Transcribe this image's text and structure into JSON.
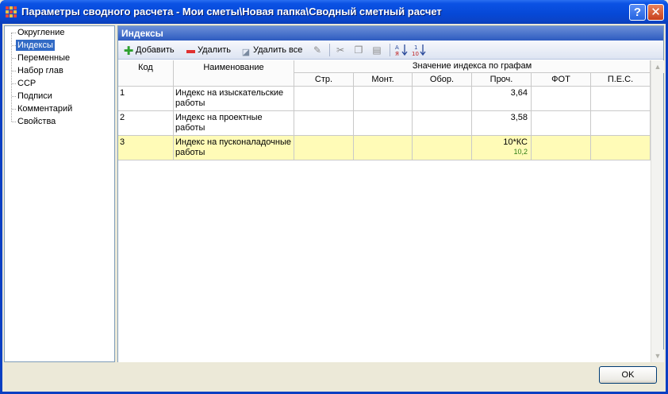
{
  "window": {
    "title": "Параметры сводного расчета - Мои сметы\\Новая папка\\Сводный сметный расчет",
    "help_label": "?",
    "close_label": "✕"
  },
  "tree": {
    "items": [
      {
        "label": "Округление",
        "selected": false
      },
      {
        "label": "Индексы",
        "selected": true
      },
      {
        "label": "Переменные",
        "selected": false
      },
      {
        "label": "Набор глав",
        "selected": false
      },
      {
        "label": "ССР",
        "selected": false
      },
      {
        "label": "Подписи",
        "selected": false
      },
      {
        "label": "Комментарий",
        "selected": false
      },
      {
        "label": "Свойства",
        "selected": false
      }
    ]
  },
  "panel": {
    "title": "Индексы"
  },
  "toolbar": {
    "add_label": "Добавить",
    "delete_label": "Удалить",
    "delete_all_label": "Удалить все"
  },
  "table": {
    "col_code": "Код",
    "col_name": "Наименование",
    "group_header": "Значение индекса по графам",
    "sub_columns": [
      "Стр.",
      "Монт.",
      "Обор.",
      "Проч.",
      "ФОТ",
      "П.Е.С."
    ],
    "rows": [
      {
        "code": "1",
        "name": "Индекс на изыскательские работы",
        "values": [
          "",
          "",
          "",
          "3,64",
          "",
          ""
        ],
        "sub": ""
      },
      {
        "code": "2",
        "name": "Индекс на проектные работы",
        "values": [
          "",
          "",
          "",
          "3,58",
          "",
          ""
        ],
        "sub": ""
      },
      {
        "code": "3",
        "name": "Индекс на пусконаладочные работы",
        "values": [
          "",
          "",
          "",
          "10*КС",
          "",
          ""
        ],
        "sub": "10,2"
      }
    ]
  },
  "footer": {
    "ok_label": "OK"
  },
  "colors": {
    "selection": "#316ac5",
    "selected_row": "#fffbb7",
    "header_blue": "#2d5bc0",
    "formula_result": "#2e7d13"
  }
}
